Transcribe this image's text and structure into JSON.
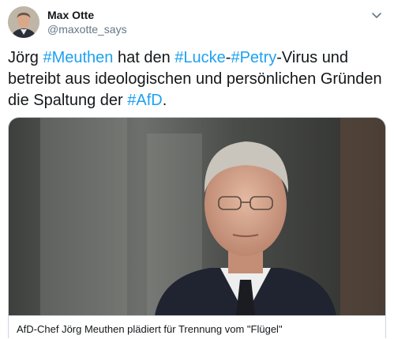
{
  "tweet": {
    "author": {
      "name": "Max Otte",
      "handle": "@maxotte_says"
    },
    "text_segments": [
      {
        "type": "text",
        "value": "Jörg "
      },
      {
        "type": "hashtag",
        "value": "#Meuthen"
      },
      {
        "type": "text",
        "value": " hat den "
      },
      {
        "type": "hashtag",
        "value": "#Lucke"
      },
      {
        "type": "text",
        "value": "-"
      },
      {
        "type": "hashtag",
        "value": "#Petry"
      },
      {
        "type": "text",
        "value": "-Virus und betreibt aus ideologischen und persönlichen Gründen die Spaltung der "
      },
      {
        "type": "hashtag",
        "value": "#AfD"
      },
      {
        "type": "text",
        "value": "."
      }
    ],
    "link_card": {
      "title": "AfD-Chef Jörg Meuthen plädiert für Trennung vom \"Flügel\""
    }
  },
  "colors": {
    "hashtag": "#1da1f2",
    "handle": "#657786",
    "border": "#ccd6dd",
    "text": "#14171a"
  },
  "icons": {
    "menu": "chevron-down-icon"
  }
}
